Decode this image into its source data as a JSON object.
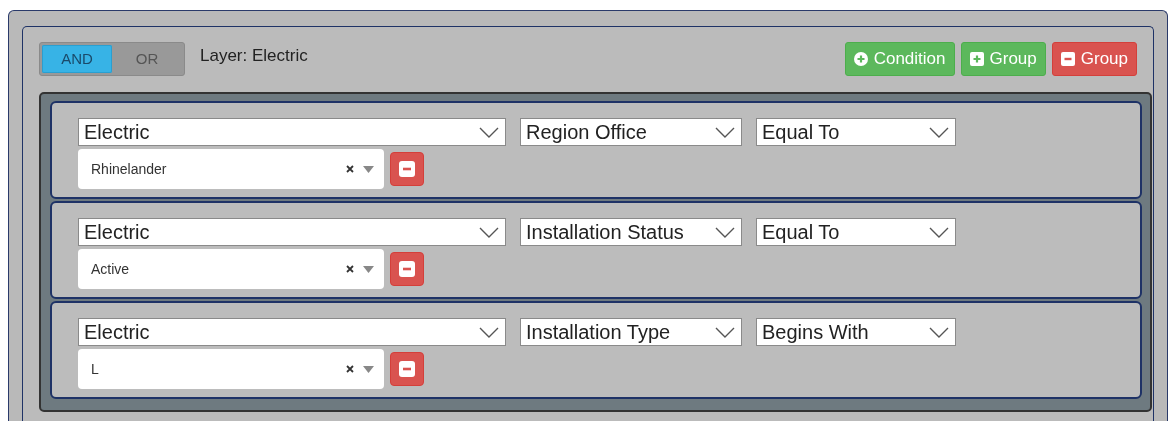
{
  "logic": [
    {
      "label": "AND",
      "selected": true
    },
    {
      "label": "OR",
      "selected": false
    }
  ],
  "layer_label": "Layer: Electric",
  "buttons": [
    {
      "label": "Condition",
      "kind": "add-condition"
    },
    {
      "label": "Group",
      "kind": "add-group"
    },
    {
      "label": "Group",
      "kind": "remove-group"
    }
  ],
  "rules": [
    {
      "layer": "Electric",
      "field": "Region Office",
      "operator": "Equal To",
      "value": "Rhinelander"
    },
    {
      "layer": "Electric",
      "field": "Installation Status",
      "operator": "Equal To",
      "value": "Active"
    },
    {
      "layer": "Electric",
      "field": "Installation Type",
      "operator": "Begins With",
      "value": "L"
    }
  ]
}
